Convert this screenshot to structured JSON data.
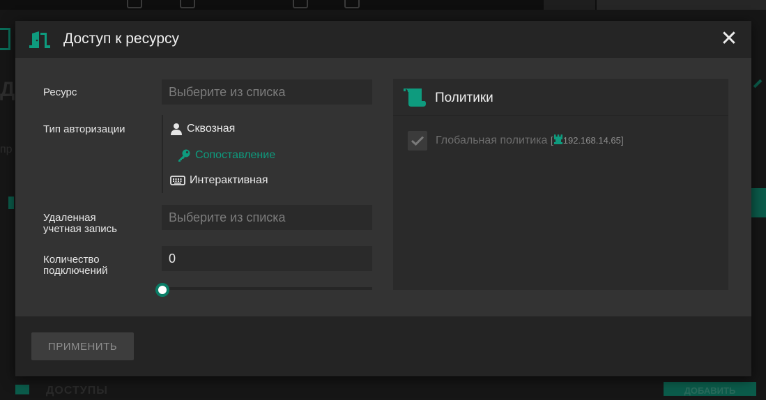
{
  "background": {
    "title_fragment": "ДО",
    "subtitle_fragment": "пр",
    "bottom_label": "ДОСТУПЫ",
    "bottom_button": "ДОБАВИТЬ"
  },
  "dialog": {
    "title": "Доступ к ресурсу",
    "icon": "door-icon",
    "close_label": "✕",
    "form": {
      "resource_label": "Ресурс",
      "resource_placeholder": "Выберите из списка",
      "resource_value": "",
      "auth_type_label": "Тип авторизации",
      "auth_options": [
        {
          "label": "Сквозная",
          "icon": "user-icon",
          "selected": false
        },
        {
          "label": "Сопоставление",
          "icon": "key-icon",
          "selected": true
        },
        {
          "label": "Интерактивная",
          "icon": "keyboard-icon",
          "selected": false
        }
      ],
      "remote_account_label_line1": "Удаленная",
      "remote_account_label_line2": "учетная запись",
      "remote_account_placeholder": "Выберите из списка",
      "remote_account_value": "",
      "connections_label_line1": "Количество",
      "connections_label_line2": "подключений",
      "connections_value": "0",
      "connections_slider_fraction": 0
    },
    "policies": {
      "title": "Политики",
      "icon": "scroll-icon",
      "items": [
        {
          "name": "Глобальная политика",
          "bracket_open": "[",
          "server_icon": "tower-icon",
          "ip": "192.168.14.65",
          "bracket_close": "]",
          "checked": true,
          "disabled": true
        }
      ]
    },
    "footer": {
      "apply_label": "ПРИМЕНИТЬ"
    }
  },
  "colors": {
    "accent": "#0e9b7e",
    "dialog_bg": "#333333",
    "header_bg": "#252525",
    "panel_bg": "#2a2a2a"
  }
}
